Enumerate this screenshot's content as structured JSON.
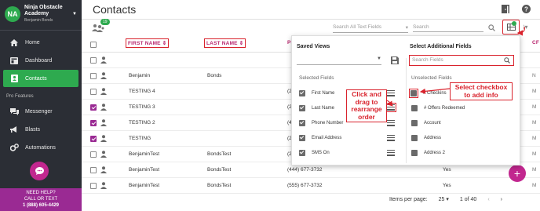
{
  "org": {
    "initials": "NA",
    "name_line1": "Ninja Obstacle",
    "name_line2": "Academy",
    "user": "Benjamin Bonds"
  },
  "nav": {
    "home": "Home",
    "dashboard": "Dashboard",
    "contacts": "Contacts",
    "section_pro": "Pro Features",
    "messenger": "Messenger",
    "blasts": "Blasts",
    "automations": "Automations"
  },
  "help": {
    "line1": "NEED HELP?",
    "line2": "CALL OR TEXT",
    "phone": "1 (888) 605-4429"
  },
  "page": {
    "title": "Contacts",
    "contact_badge": "19",
    "search_all_placeholder": "Search All Text Fields",
    "search_placeholder": "Search"
  },
  "table": {
    "headers": {
      "first_name": "FIRST NAME ⇕",
      "last_name": "LAST NAME ⇕",
      "phone_partial": "PI",
      "cr_partial": "CF"
    },
    "rows": [
      {
        "first": "",
        "last": "",
        "phone": "",
        "yes": "",
        "tail": "",
        "checked": false
      },
      {
        "first": "Benjamin",
        "last": "Bonds",
        "phone": "",
        "yes": "",
        "tail": "N",
        "checked": false
      },
      {
        "first": "TESTING 4",
        "last": "",
        "phone": "(2",
        "yes": "",
        "tail": "M",
        "checked": false
      },
      {
        "first": "TESTING 3",
        "last": "",
        "phone": "(2",
        "yes": "",
        "tail": "M",
        "checked": true
      },
      {
        "first": "TESTING 2",
        "last": "",
        "phone": "(4",
        "yes": "",
        "tail": "M",
        "checked": true
      },
      {
        "first": "TESTING",
        "last": "",
        "phone": "(2",
        "yes": "",
        "tail": "M",
        "checked": true
      },
      {
        "first": "BenjaminTest",
        "last": "BondsTest",
        "phone": "(2",
        "yes": "",
        "tail": "M",
        "checked": false
      },
      {
        "first": "BenjaminTest",
        "last": "BondsTest",
        "phone": "(444) 677-3732",
        "yes": "Yes",
        "tail": "M",
        "checked": false
      },
      {
        "first": "BenjaminTest",
        "last": "BondsTest",
        "phone": "(555) 677-3732",
        "yes": "Yes",
        "tail": "M",
        "checked": false
      }
    ]
  },
  "pager": {
    "label": "Items per page:",
    "per_page": "25",
    "range": "1 of 40"
  },
  "popup": {
    "saved_views_title": "Saved Views",
    "additional_title": "Select Additional Fields",
    "search_fields_placeholder": "Search Fields",
    "selected_fields_title": "Selected Fields",
    "unselected_fields_title": "Unselected Fields",
    "selected": [
      "First Name",
      "Last Name",
      "Phone Number",
      "Email Address",
      "SMS On"
    ],
    "unselected": [
      "# Checkins",
      "# Offers Redeemed",
      "Account",
      "Address",
      "Address 2"
    ]
  },
  "annotations": {
    "drag_line1": "Click and",
    "drag_line2": "drag to",
    "drag_line3": "rearrange",
    "drag_line4": "order",
    "select_line1": "Select checkbox",
    "select_line2": "to add info"
  },
  "colors": {
    "green": "#2eaa4f",
    "magenta": "#c2278f",
    "purple": "#9a2a93",
    "annotation_red": "#d9232d"
  }
}
